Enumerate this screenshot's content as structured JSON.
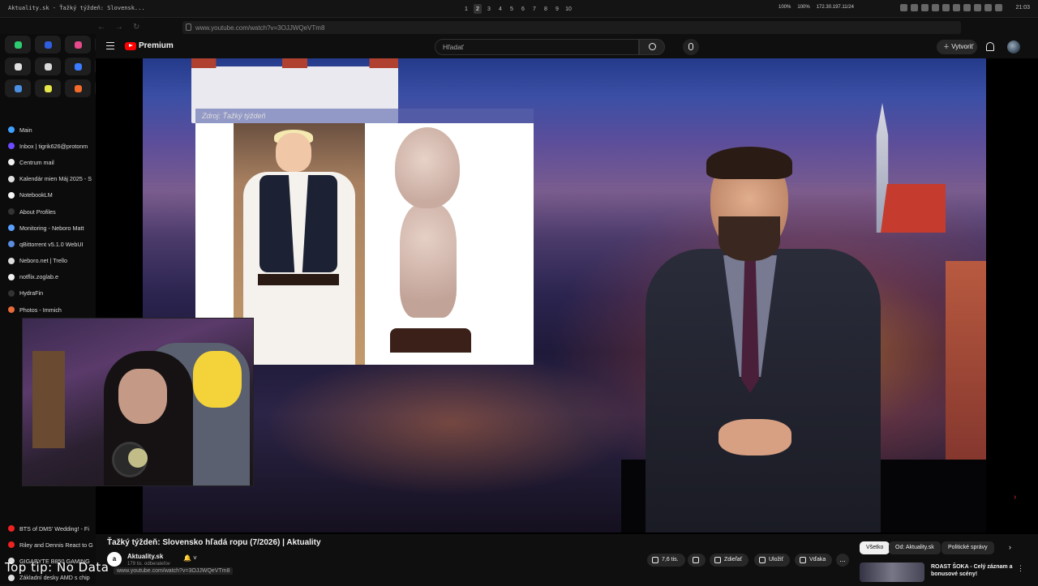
{
  "window": {
    "title": "Aktuality.sk - Ťažký týždeň: Slovensk...",
    "workspaces": [
      "1",
      "2",
      "3",
      "4",
      "5",
      "6",
      "7",
      "8",
      "9",
      "10"
    ],
    "active_workspace": "2",
    "tray_text": [
      "100%",
      "100%",
      "172.30.197.11/24"
    ],
    "clock": "21:03"
  },
  "browser": {
    "url": "www.youtube.com/watch?v=3OJJWQeVTm8",
    "pinned_tabs": [
      {
        "icon": "whatsapp-icon",
        "color": "#2ecc71"
      },
      {
        "icon": "messenger-icon",
        "color": "#2f5fe0"
      },
      {
        "icon": "instagram-icon",
        "color": "#e64a8a"
      },
      {
        "icon": "x-icon",
        "color": "#dddddd"
      },
      {
        "icon": "gmail-icon",
        "color": "#e0e0e0"
      },
      {
        "icon": "gmail-icon",
        "color": "#d9d9d9"
      },
      {
        "icon": "chat-icon",
        "color": "#3a7bff"
      },
      {
        "icon": "drive-icon",
        "color": "#28b4d8"
      },
      {
        "icon": "docs-icon",
        "color": "#4a90e2"
      },
      {
        "icon": "notes-icon",
        "color": "#e6e64a"
      },
      {
        "icon": "gitlab-icon",
        "color": "#f26b2a"
      },
      {
        "icon": "github-icon",
        "color": "#dddddd"
      }
    ],
    "bookmarks": [
      {
        "label": "Main",
        "color": "#3fa0ff"
      },
      {
        "label": "Inbox | tigrik626@protonm",
        "color": "#6d4aff"
      },
      {
        "label": "Centrum mail",
        "color": "#f0f0f0"
      },
      {
        "label": "Kalendár mien Máj 2025 - S",
        "color": "#e0e0e0"
      },
      {
        "label": "NotebookLM",
        "color": "#f5f5f5"
      },
      {
        "label": "About Profiles",
        "color": "#333333"
      },
      {
        "label": "Monitoring - Neboro Matt",
        "color": "#5aa0ff"
      },
      {
        "label": "qBittorrent v5.1.0 WebUI",
        "color": "#5a8de0"
      },
      {
        "label": "Neboro.net | Trello",
        "color": "#dddddd"
      },
      {
        "label": "notflix.zoglab.e",
        "color": "#f0f0f0"
      },
      {
        "label": "HydraFin",
        "color": "#333333"
      },
      {
        "label": "Photos - Immich",
        "color": "#e86a3a"
      }
    ],
    "bookmarks_lower": [
      {
        "label": "BTS of DMS' Wedding! - Fi",
        "color": "#e22"
      },
      {
        "label": "Riley and Dennis React to G",
        "color": "#e22"
      },
      {
        "label": "GIGABYTE B850 GAMING",
        "color": "#ddd"
      },
      {
        "label": "Základní desky AMD s chip",
        "color": "#ddd"
      }
    ]
  },
  "youtube": {
    "logo_text": "Premium",
    "search_placeholder": "Hľadať",
    "create_label": "Vytvoriť",
    "video": {
      "overlay_source": "Zdroj: Ťažký týždeň",
      "title": "Ťažký týždeň: Slovensko hľadá ropu (7/2026) | Aktuality",
      "channel": "Aktuality.sk",
      "channel_logo": "a",
      "subscribers": "179 tis. odberateľov",
      "likes": "7,6 tis.",
      "share_label": "Zdieľať",
      "save_label": "Uložiť",
      "thanks_label": "Vďaka",
      "more_label": "..."
    },
    "chips": [
      "Všetko",
      "Od: Aktuality.sk",
      "Politické správy"
    ],
    "selected_chip": "Všetko",
    "recommendation": {
      "title": "ROAST ŠOKA - Celý záznam a bonusové scény!"
    }
  },
  "overlay": {
    "tip_label": "Top tip:",
    "tip_value": "No Data",
    "status_url": "www.youtube.com/watch?v=3OJJWQeVTm8"
  }
}
